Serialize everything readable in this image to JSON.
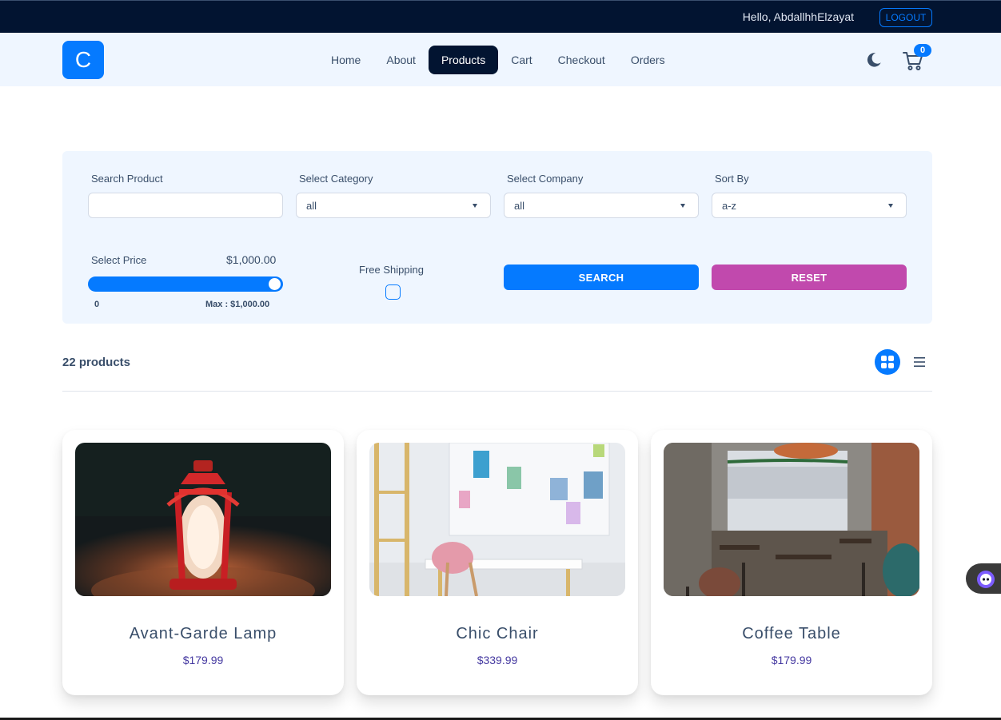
{
  "topbar": {
    "greeting": "Hello, AbdallhhElzayat",
    "logout_label": "LOGOUT"
  },
  "navbar": {
    "logo_letter": "C",
    "links": [
      {
        "label": "Home"
      },
      {
        "label": "About"
      },
      {
        "label": "Products",
        "active": true
      },
      {
        "label": "Cart"
      },
      {
        "label": "Checkout"
      },
      {
        "label": "Orders"
      }
    ],
    "theme_icon": "moon-icon",
    "cart_icon": "cart-icon",
    "cart_count": "0"
  },
  "filters": {
    "search": {
      "label": "Search Product",
      "value": ""
    },
    "category": {
      "label": "Select Category",
      "value": "all"
    },
    "company": {
      "label": "Select Company",
      "value": "all"
    },
    "sort": {
      "label": "Sort By",
      "value": "a-z"
    },
    "price": {
      "label": "Select Price",
      "value": "$1,000.00",
      "min": "0",
      "max": "Max : $1,000.00",
      "fill_fraction": 1.0
    },
    "shipping": {
      "label": "Free Shipping",
      "checked": false
    },
    "search_button": "SEARCH",
    "reset_button": "RESET"
  },
  "products_header": {
    "count": "22 products",
    "grid_icon": "grid-icon",
    "list_icon": "list-icon"
  },
  "products": [
    {
      "title": "Avant-Garde Lamp",
      "price": "$179.99",
      "image": "lantern-photo"
    },
    {
      "title": "Chic Chair",
      "price": "$339.99",
      "image": "chair-room-photo"
    },
    {
      "title": "Coffee Table",
      "price": "$179.99",
      "image": "cafe-interior-photo"
    }
  ],
  "colors": {
    "primary": "#057aff",
    "secondary": "#c149ad",
    "dark": "#021431",
    "light_bg": "#eff6ff"
  }
}
